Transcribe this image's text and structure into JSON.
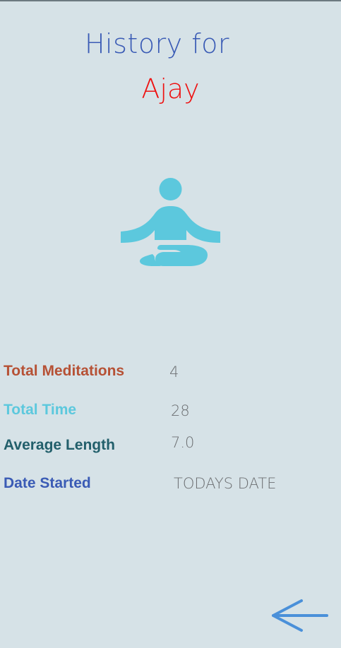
{
  "header": {
    "title": "History for",
    "user_name": "Ajay"
  },
  "hero": {
    "icon": "meditation-icon",
    "color": "#5cc8dd"
  },
  "stats": {
    "total_meditations": {
      "label": "Total Meditations",
      "value": "4",
      "color": "#b65135"
    },
    "total_time": {
      "label": "Total Time",
      "value": "28",
      "color": "#5cc8dd"
    },
    "average_length": {
      "label": "Average Length",
      "value": "7.0",
      "color": "#225f6b"
    },
    "date_started": {
      "label": "Date Started",
      "value": "TODAYS DATE",
      "color": "#3a5bb5"
    }
  },
  "navigation": {
    "back_icon": "arrow-left-icon",
    "color": "#4a90d9"
  }
}
